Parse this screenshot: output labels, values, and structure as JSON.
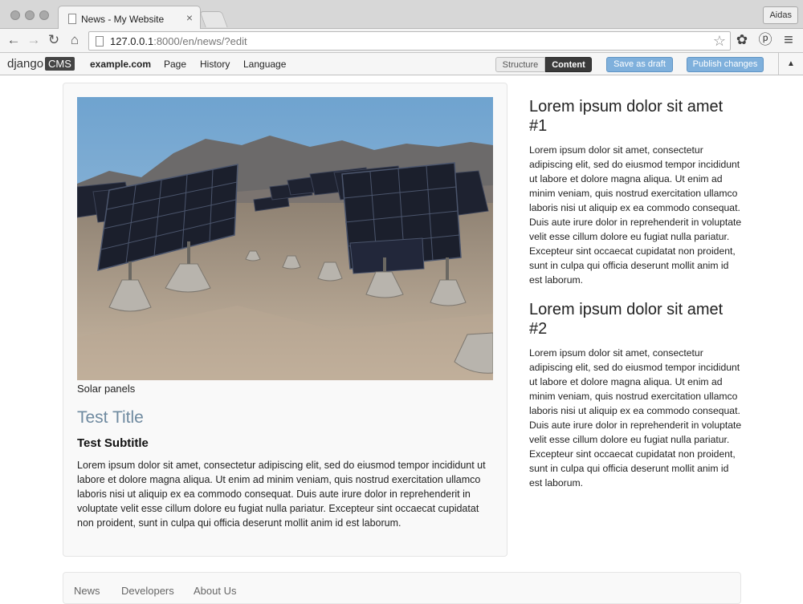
{
  "browser": {
    "tab_title": "News - My Website",
    "tab_close": "×",
    "profile": "Aidas",
    "url_host": "127.0.0.1",
    "url_rest": ":8000/en/news/?edit",
    "back_glyph": "←",
    "forward_glyph": "→",
    "reload_glyph": "↻",
    "home_glyph": "⌂",
    "star_glyph": "☆",
    "settings_glyph": "✿",
    "pinterest_glyph": "ⓟ",
    "menu_glyph": "≡"
  },
  "cms": {
    "logo_text": "django",
    "logo_box": "CMS",
    "site": "example.com",
    "menu": [
      "Page",
      "History",
      "Language"
    ],
    "mode_structure": "Structure",
    "mode_content": "Content",
    "save_draft": "Save as draft",
    "publish": "Publish changes",
    "collapse_glyph": "▲"
  },
  "article": {
    "caption": "Solar panels",
    "title": "Test Title",
    "subtitle": "Test Subtitle",
    "body": "Lorem ipsum dolor sit amet, consectetur adipiscing elit, sed do eiusmod tempor incididunt ut labore et dolore magna aliqua. Ut enim ad minim veniam, quis nostrud exercitation ullamco laboris nisi ut aliquip ex ea commodo consequat. Duis aute irure dolor in reprehenderit in voluptate velit esse cillum dolore eu fugiat nulla pariatur. Excepteur sint occaecat cupidatat non proident, sunt in culpa qui officia deserunt mollit anim id est laborum."
  },
  "sidebar": [
    {
      "title": "Lorem ipsum dolor sit amet #1",
      "body": "Lorem ipsum dolor sit amet, consectetur adipiscing elit, sed do eiusmod tempor incididunt ut labore et dolore magna aliqua. Ut enim ad minim veniam, quis nostrud exercitation ullamco laboris nisi ut aliquip ex ea commodo consequat. Duis aute irure dolor in reprehenderit in voluptate velit esse cillum dolore eu fugiat nulla pariatur. Excepteur sint occaecat cupidatat non proident, sunt in culpa qui officia deserunt mollit anim id est laborum."
    },
    {
      "title": "Lorem ipsum dolor sit amet #2",
      "body": "Lorem ipsum dolor sit amet, consectetur adipiscing elit, sed do eiusmod tempor incididunt ut labore et dolore magna aliqua. Ut enim ad minim veniam, quis nostrud exercitation ullamco laboris nisi ut aliquip ex ea commodo consequat. Duis aute irure dolor in reprehenderit in voluptate velit esse cillum dolore eu fugiat nulla pariatur. Excepteur sint occaecat cupidatat non proident, sunt in culpa qui officia deserunt mollit anim id est laborum."
    }
  ],
  "footer": {
    "links": [
      "News",
      "Developers",
      "About Us"
    ]
  },
  "colors": {
    "title_accent": "#6f8aa0",
    "cms_action_blue": "#7fb0dc",
    "cms_content_dark": "#3a3a3a"
  }
}
